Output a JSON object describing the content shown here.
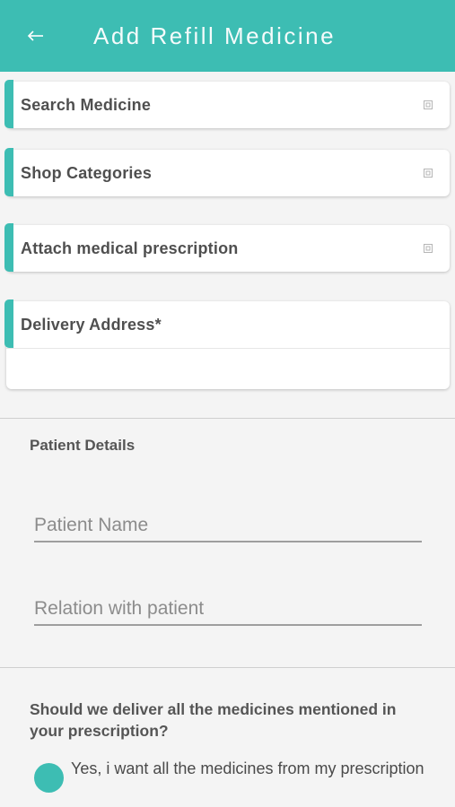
{
  "header": {
    "title": "Add Refill Medicine",
    "back_icon": "arrow-left-icon",
    "background_color": "#3dbdb3"
  },
  "cards": {
    "search_medicine": {
      "label": "Search Medicine",
      "icon": "expand-icon"
    },
    "shop_categories": {
      "label": "Shop Categories",
      "icon": "expand-icon"
    },
    "attach_prescription": {
      "label": "Attach medical prescription",
      "icon": "expand-icon"
    },
    "delivery_address": {
      "label": "Delivery Address*"
    }
  },
  "patient": {
    "section_title": "Patient Details",
    "name_placeholder": "Patient Name",
    "relation_placeholder": "Relation with patient"
  },
  "delivery_question": {
    "text": "Should we deliver all the medicines mentioned in your prescription?",
    "option_all": "Yes, i want all the medicines from my prescription"
  },
  "accent_color": "#3dbdb3"
}
